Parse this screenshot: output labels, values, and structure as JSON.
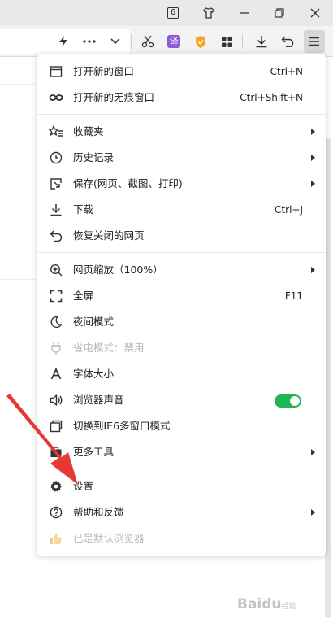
{
  "titlebar": {
    "tab_count": "6",
    "icons": [
      "tabs-count-icon",
      "skin-shirt-icon",
      "minimize-icon",
      "restore-icon",
      "close-icon"
    ]
  },
  "toolbar": {
    "icons": [
      "lightning-icon",
      "more-dots-icon",
      "chevron-down-icon",
      "scissors-icon",
      "translate-icon",
      "shield-icon",
      "apps-grid-icon",
      "download-icon",
      "undo-icon",
      "menu-icon"
    ],
    "translate_label": "译"
  },
  "menu": {
    "items": [
      {
        "label": "打开新的窗口",
        "shortcut": "Ctrl+N"
      },
      {
        "label": "打开新的无痕窗口",
        "shortcut": "Ctrl+Shift+N"
      },
      {
        "label": "收藏夹"
      },
      {
        "label": "历史记录"
      },
      {
        "label": "保存(网页、截图、打印)"
      },
      {
        "label": "下载",
        "shortcut": "Ctrl+J"
      },
      {
        "label": "恢复关闭的网页"
      },
      {
        "label": "网页缩放（100%）"
      },
      {
        "label": "全屏",
        "shortcut": "F11"
      },
      {
        "label": "夜间模式"
      },
      {
        "label": "省电模式：禁用"
      },
      {
        "label": "字体大小"
      },
      {
        "label": "浏览器声音",
        "toggle_on": true
      },
      {
        "label": "切换到IE6多窗口模式"
      },
      {
        "label": "更多工具"
      },
      {
        "label": "设置"
      },
      {
        "label": "帮助和反馈"
      },
      {
        "label": "已是默认浏览器"
      }
    ]
  },
  "colors": {
    "toggle_on": "#1fb553",
    "annotation_arrow": "#e53935",
    "translate_badge": "#8e5bd6",
    "shield_badge": "#f5a623"
  },
  "watermark": {
    "text": "Baidu",
    "sub": "经验"
  }
}
